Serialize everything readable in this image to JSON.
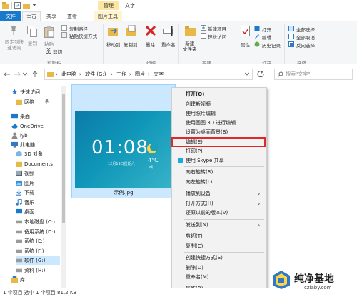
{
  "window": {
    "title": "文字",
    "context_tab_header": "管理"
  },
  "tabs": {
    "file": "文件",
    "home": "主页",
    "share": "共享",
    "view": "查看",
    "picture_tools": "图片工具"
  },
  "ribbon": {
    "pin_quick_access": "固定到快\n速访问",
    "copy": "复制",
    "paste": "粘贴",
    "cut": "剪切",
    "copy_path": "复制路径",
    "paste_shortcut": "粘贴快捷方式",
    "move_to": "移动到",
    "copy_to": "复制到",
    "delete": "删除",
    "rename": "重命名",
    "new_folder": "新建\n文件夹",
    "new_item": "新建项目",
    "easy_access": "轻松访问",
    "properties": "属性",
    "open": "打开",
    "edit": "编辑",
    "history": "历史记录",
    "select_all": "全部选择",
    "select_none": "全部取消",
    "invert_selection": "反向选择",
    "groups": {
      "clipboard": "剪贴板",
      "organize": "组织",
      "new": "新建",
      "open": "打开",
      "select": "选择"
    }
  },
  "address": {
    "crumbs": [
      "此电脑",
      "软件 (G:)",
      "工作",
      "图片",
      "文字"
    ],
    "search_placeholder": "搜索\"文字\""
  },
  "nav": {
    "items": [
      {
        "label": "快速访问",
        "icon": "star-icon"
      },
      {
        "label": "网络",
        "icon": "folder-icon"
      },
      {
        "label": "桌面",
        "icon": "desktop-icon"
      },
      {
        "label": "OneDrive",
        "icon": "cloud-icon"
      },
      {
        "label": "lyb",
        "icon": "user-icon"
      },
      {
        "label": "此电脑",
        "icon": "computer-icon"
      },
      {
        "label": "3D 对象",
        "icon": "cube-icon"
      },
      {
        "label": "Documents",
        "icon": "folder-icon"
      },
      {
        "label": "视频",
        "icon": "video-icon"
      },
      {
        "label": "图片",
        "icon": "picture-icon"
      },
      {
        "label": "下载",
        "icon": "download-icon"
      },
      {
        "label": "音乐",
        "icon": "music-icon"
      },
      {
        "label": "桌面",
        "icon": "desktop-icon"
      },
      {
        "label": "本地磁盘 (C:)",
        "icon": "drive-icon"
      },
      {
        "label": "备用系统 (D:)",
        "icon": "drive-icon"
      },
      {
        "label": "系统 (E:)",
        "icon": "drive-icon"
      },
      {
        "label": "系统 (F:)",
        "icon": "drive-icon"
      },
      {
        "label": "软件 (G:)",
        "icon": "drive-icon"
      },
      {
        "label": "资料 (H:)",
        "icon": "drive-icon"
      },
      {
        "label": "库",
        "icon": "library-icon"
      }
    ]
  },
  "file": {
    "name": "示例.jpg",
    "thumb_time": "01:08",
    "thumb_date": "12月19日星期六",
    "thumb_temp": "4°C",
    "thumb_weather": "晴"
  },
  "context_menu": {
    "items": [
      "打开(O)",
      "创建新视频",
      "使用照片编辑",
      "使用画图 3D 进行编辑",
      "设置为桌面背景(B)",
      "编辑(E)",
      "打印(P)",
      "使用 Skype 共享",
      "向右旋转(R)",
      "向左旋转(L)",
      "播放到设备",
      "打开方式(H)",
      "还原以前的版本(V)",
      "发送到(N)",
      "剪切(T)",
      "复制(C)",
      "创建快捷方式(S)",
      "删除(D)",
      "重命名(M)",
      "属性(R)"
    ]
  },
  "status": {
    "text": "1 个项目  选中 1 个项目 81.2 KB"
  },
  "watermark": {
    "title": "纯净基地",
    "url": "czlaby.com"
  }
}
